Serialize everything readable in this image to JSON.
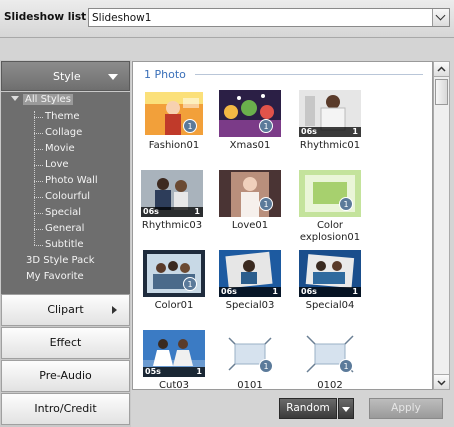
{
  "header": {
    "label": "Slideshow list :",
    "selected": "Slideshow1"
  },
  "sidebar": {
    "style_label": "Style",
    "tree": {
      "root": "All Styles",
      "children": [
        "Theme",
        "Collage",
        "Movie",
        "Love",
        "Photo Wall",
        "Colourful",
        "Special",
        "General",
        "Subtitle"
      ],
      "others": [
        "3D Style Pack",
        "My Favorite"
      ]
    },
    "buttons": [
      "Clipart",
      "Effect",
      "Pre-Audio",
      "Intro/Credit"
    ]
  },
  "main": {
    "section_title": "1 Photo",
    "items": [
      {
        "label": "Fashion01",
        "badge": "1",
        "duration": "",
        "count": ""
      },
      {
        "label": "Xmas01",
        "badge": "1",
        "duration": "",
        "count": ""
      },
      {
        "label": "Rhythmic01",
        "badge": "",
        "duration": "06s",
        "count": "1"
      },
      {
        "label": "Rhythmic03",
        "badge": "",
        "duration": "06s",
        "count": "1"
      },
      {
        "label": "Love01",
        "badge": "1",
        "duration": "",
        "count": ""
      },
      {
        "label": "Color explosion01",
        "badge": "1",
        "duration": "",
        "count": ""
      },
      {
        "label": "Color01",
        "badge": "1",
        "duration": "",
        "count": ""
      },
      {
        "label": "Special03",
        "badge": "",
        "duration": "06s",
        "count": "1"
      },
      {
        "label": "Special04",
        "badge": "",
        "duration": "06s",
        "count": "1"
      },
      {
        "label": "Cut03",
        "badge": "",
        "duration": "05s",
        "count": "1"
      },
      {
        "label": "0101",
        "badge": "1",
        "duration": "",
        "count": ""
      },
      {
        "label": "0102",
        "badge": "1",
        "duration": "",
        "count": ""
      }
    ]
  },
  "footer": {
    "random_label": "Random",
    "apply_label": "Apply"
  }
}
